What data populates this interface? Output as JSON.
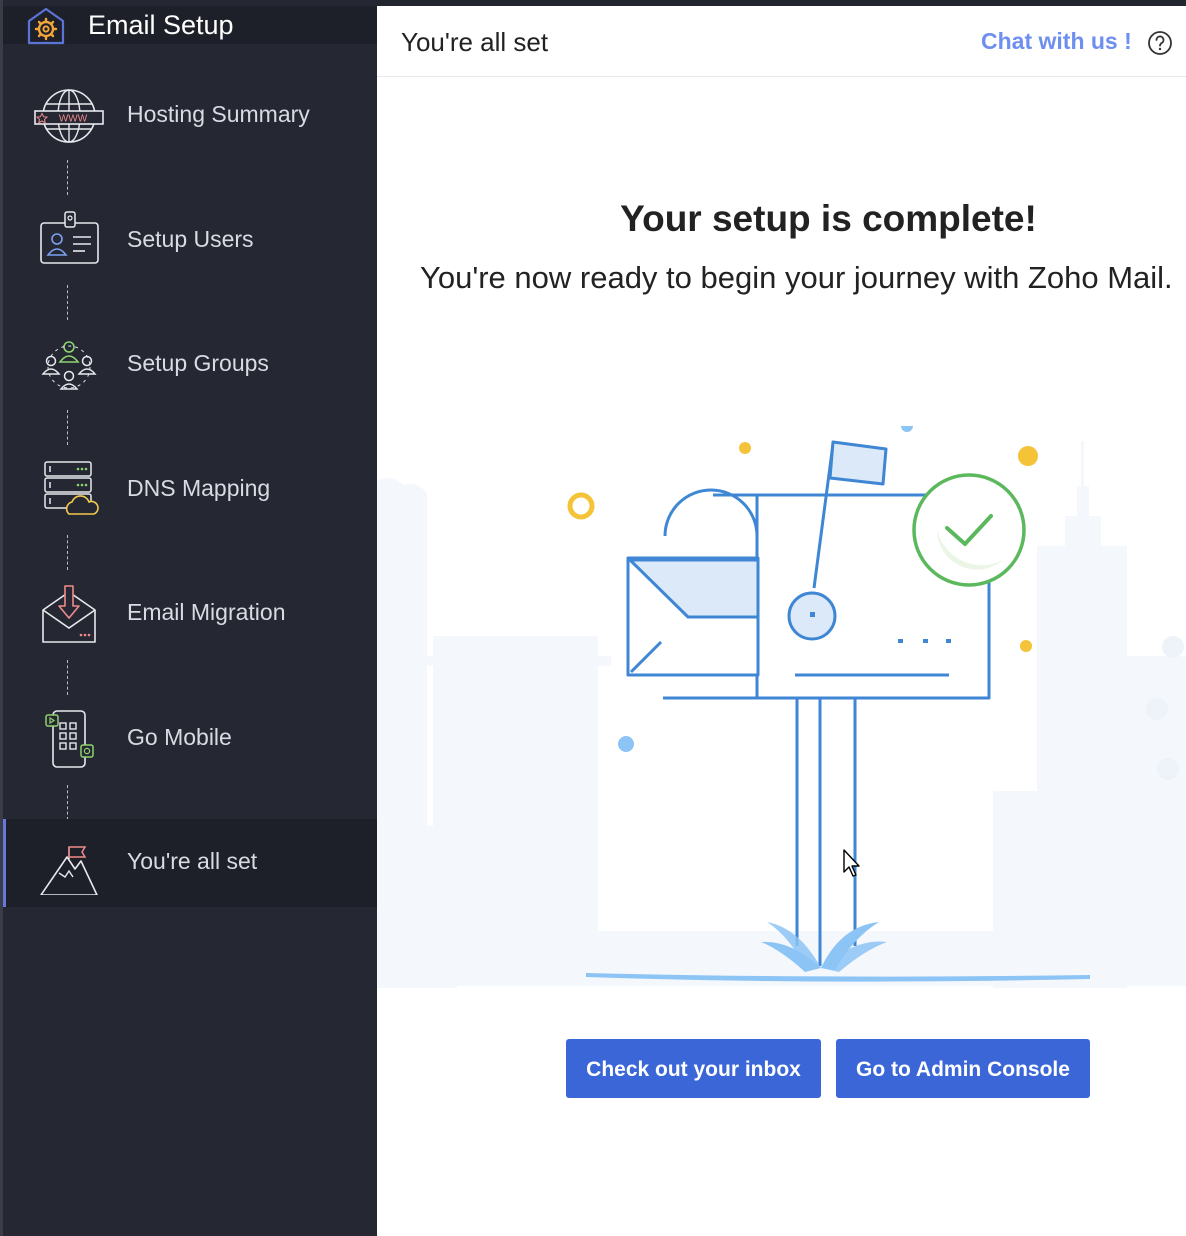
{
  "sidebar": {
    "title": "Email Setup",
    "steps": [
      {
        "label": "Hosting Summary",
        "icon": "globe-www-icon"
      },
      {
        "label": "Setup Users",
        "icon": "id-card-icon"
      },
      {
        "label": "Setup Groups",
        "icon": "group-icon"
      },
      {
        "label": "DNS Mapping",
        "icon": "server-cloud-icon"
      },
      {
        "label": "Email Migration",
        "icon": "envelope-download-icon"
      },
      {
        "label": "Go Mobile",
        "icon": "mobile-apps-icon"
      },
      {
        "label": "You're all set",
        "icon": "mountain-flag-icon",
        "active": true
      }
    ]
  },
  "main": {
    "header_title": "You're all set",
    "chat_label": "Chat with us !",
    "headline": "Your setup is complete!",
    "subline": "You're now ready to begin your journey with Zoho Mail.",
    "buttons": {
      "inbox": "Check out your inbox",
      "admin": "Go to Admin Console"
    }
  },
  "colors": {
    "sidebar_bg": "#252833",
    "accent": "#3b66d8",
    "link": "#6e8ef0",
    "illustration_blue": "#3f86d4",
    "check_green": "#5cb85c"
  }
}
